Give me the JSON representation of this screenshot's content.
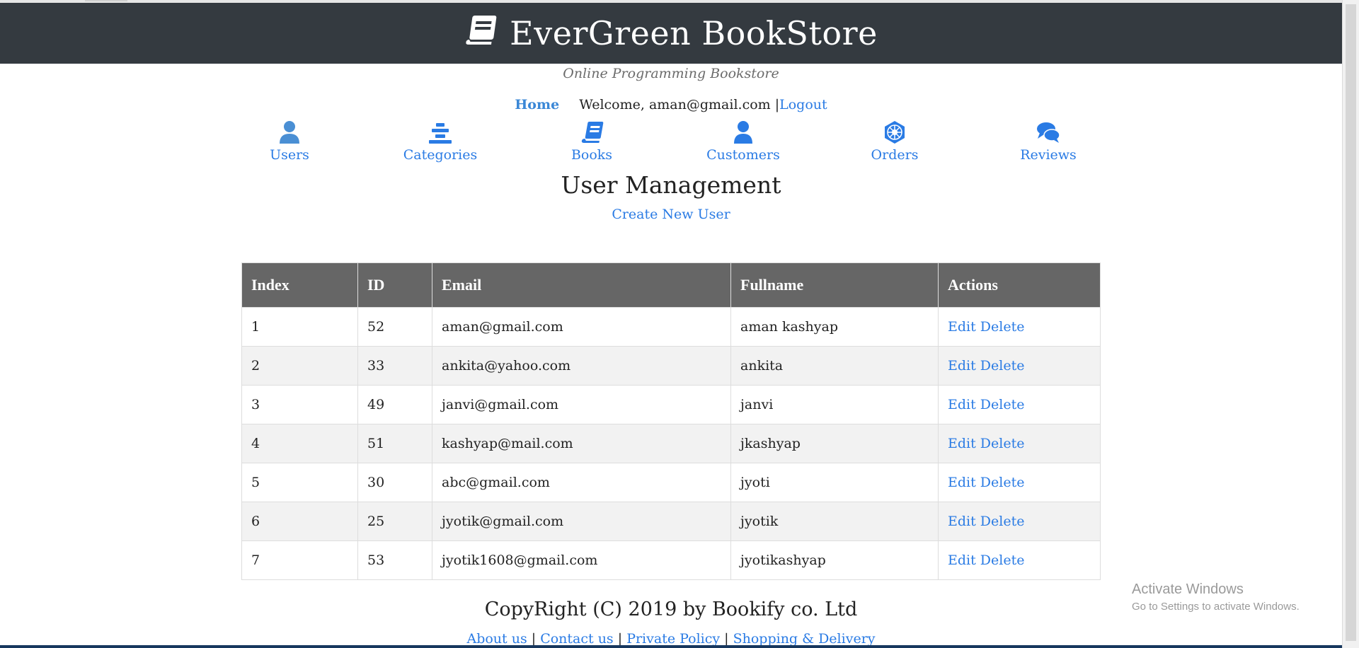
{
  "header": {
    "title": "EverGreen BookStore",
    "tagline": "Online Programming Bookstore"
  },
  "userbar": {
    "home": "Home",
    "welcome": "Welcome, aman@gmail.com |",
    "logout": "Logout"
  },
  "nav": [
    {
      "label": "Users",
      "icon": "user-icon"
    },
    {
      "label": "Categories",
      "icon": "stack-icon"
    },
    {
      "label": "Books",
      "icon": "book-icon"
    },
    {
      "label": "Customers",
      "icon": "user-icon"
    },
    {
      "label": "Orders",
      "icon": "galactic-icon"
    },
    {
      "label": "Reviews",
      "icon": "comments-icon"
    }
  ],
  "page": {
    "title": "User Management",
    "create_link": "Create New User"
  },
  "table": {
    "columns": [
      "Index",
      "ID",
      "Email",
      "Fullname",
      "Actions"
    ],
    "rows": [
      {
        "index": "1",
        "id": "52",
        "email": "aman@gmail.com",
        "fullname": "aman kashyap"
      },
      {
        "index": "2",
        "id": "33",
        "email": "ankita@yahoo.com",
        "fullname": "ankita"
      },
      {
        "index": "3",
        "id": "49",
        "email": "janvi@gmail.com",
        "fullname": "janvi"
      },
      {
        "index": "4",
        "id": "51",
        "email": "kashyap@mail.com",
        "fullname": "jkashyap"
      },
      {
        "index": "5",
        "id": "30",
        "email": "abc@gmail.com",
        "fullname": "jyoti"
      },
      {
        "index": "6",
        "id": "25",
        "email": "jyotik@gmail.com",
        "fullname": "jyotik"
      },
      {
        "index": "7",
        "id": "53",
        "email": "jyotik1608@gmail.com",
        "fullname": "jyotikashyap"
      }
    ],
    "edit_label": "Edit",
    "delete_label": "Delete"
  },
  "watermark": {
    "line1": "Activate Windows",
    "line2": "Go to Settings to activate Windows."
  },
  "footer": {
    "copyright": "CopyRight (C) 2019 by Bookify co. Ltd",
    "links": [
      "About us",
      "Contact us",
      "Private Policy",
      "Shopping & Delivery"
    ],
    "separator": "|"
  },
  "colors": {
    "header_bg": "#343a40",
    "link": "#2a7be4",
    "table_header_bg": "#666666",
    "row_alt": "#f2f2f2"
  }
}
